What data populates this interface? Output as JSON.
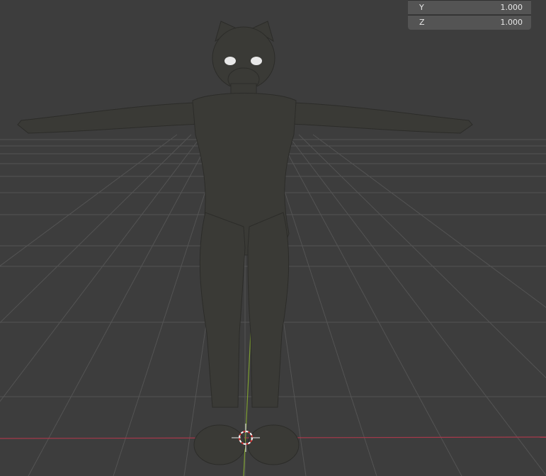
{
  "viewport": {
    "background_color": "#3d3d3d",
    "grid_color": "#545454",
    "x_axis_color": "#a7394b",
    "y_axis_color": "#7d9e31",
    "model_color": "#3a3a36"
  },
  "transform_panel": {
    "rows": [
      {
        "axis": "Y",
        "value": "1.000"
      },
      {
        "axis": "Z",
        "value": "1.000"
      }
    ]
  },
  "cursor": {
    "icon": "3d-cursor-icon"
  }
}
